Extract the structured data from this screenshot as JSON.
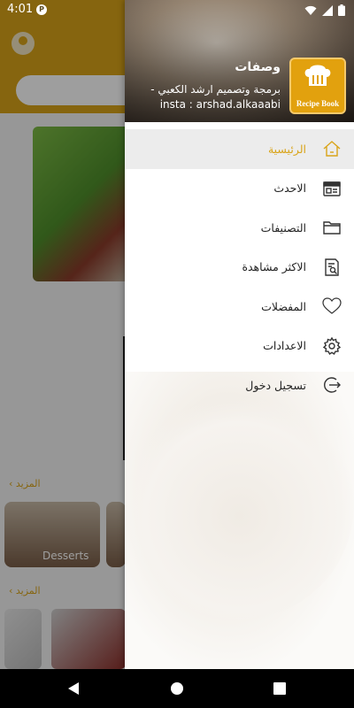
{
  "status_bar": {
    "time": "4:01",
    "notification_badge": "P"
  },
  "drawer": {
    "header": {
      "app_name": "وصفات",
      "developer_credit": "برمجة وتصميم ارشد الكعبي -",
      "instagram": "insta : arshad.alkaaabi",
      "logo_text": "Recipe Book"
    },
    "menu": [
      {
        "label": "الرئيسية",
        "icon": "home-icon",
        "active": true
      },
      {
        "label": "الاحدث",
        "icon": "calendar-icon",
        "active": false
      },
      {
        "label": "التصنيفات",
        "icon": "folder-icon",
        "active": false
      },
      {
        "label": "الاكثر مشاهدة",
        "icon": "document-search-icon",
        "active": false
      },
      {
        "label": "المفضلات",
        "icon": "heart-icon",
        "active": false
      },
      {
        "label": "الاعدادات",
        "icon": "gear-icon",
        "active": false
      },
      {
        "label": "تسجيل دخول",
        "icon": "login-icon",
        "active": false
      }
    ]
  },
  "background_app": {
    "more_label_1": "المزيد",
    "more_label_2": "المزيد",
    "category_label": "Desserts"
  },
  "colors": {
    "accent": "#d9a419",
    "active_row": "#ececec",
    "logo": "#e2a10e"
  }
}
